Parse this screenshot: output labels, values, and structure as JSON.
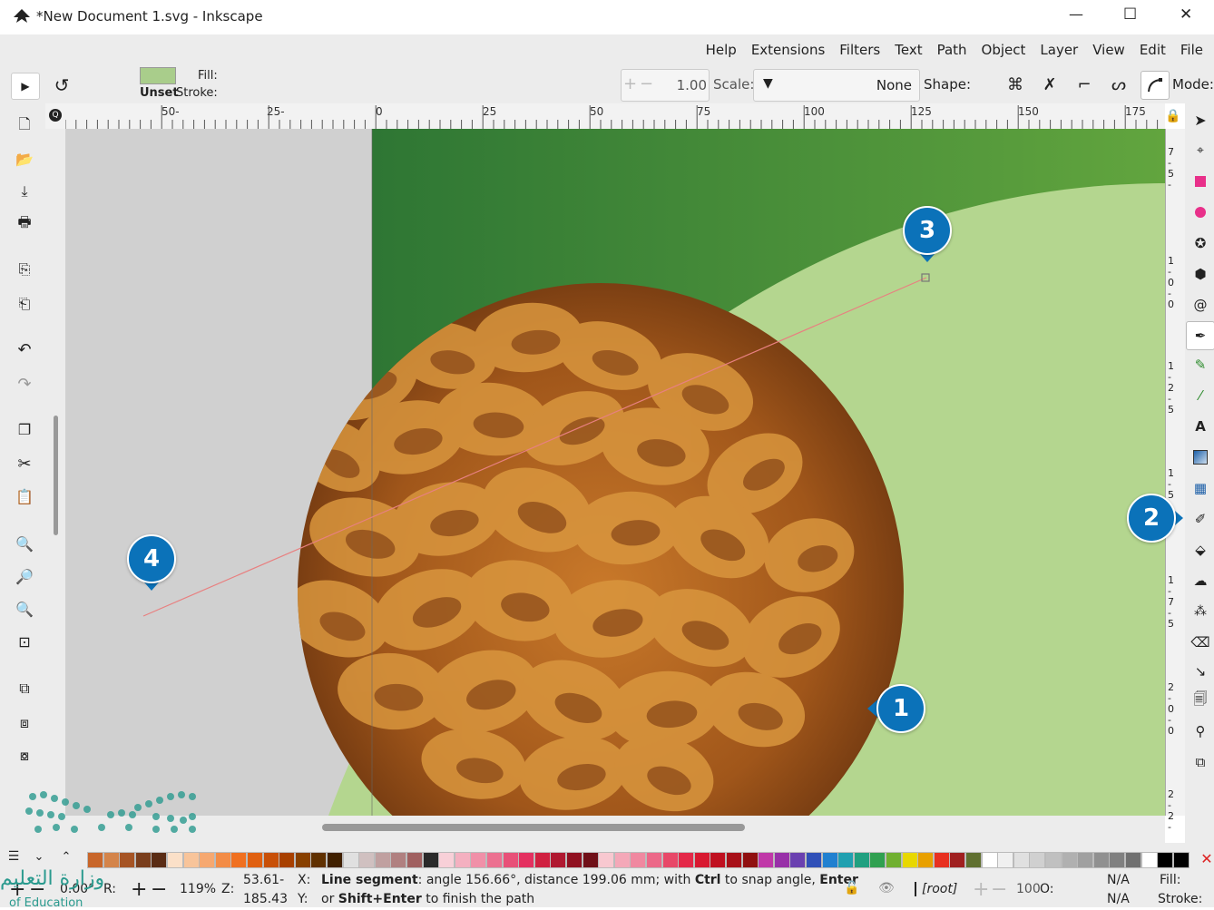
{
  "window": {
    "title": "*New Document 1.svg - Inkscape",
    "minimize_glyph": "—",
    "maximize_glyph": "☐",
    "close_glyph": "✕"
  },
  "menu": [
    "File",
    "Edit",
    "View",
    "Layer",
    "Object",
    "Path",
    "Text",
    "Filters",
    "Extensions",
    "Help"
  ],
  "tool_controls": {
    "mode_label": "Mode:",
    "shape_label": "Shape:",
    "shape_value": "None",
    "scale_label": "Scale:",
    "scale_value": "1.00",
    "fill_label": "Fill:",
    "stroke_label": "Stroke:",
    "stroke_value": "Unset",
    "fill_color": "#a9cd8b"
  },
  "ruler_top": [
    "50-",
    "25-",
    "0",
    "25",
    "50",
    "75",
    "100",
    "125",
    "150",
    "175"
  ],
  "ruler_right": [
    "7-5-",
    "1-0-0",
    "1-2-5",
    "1-5-",
    "1-7-5",
    "2-0-0",
    "2-2-"
  ],
  "badges": [
    "1",
    "2",
    "3",
    "4"
  ],
  "colors": {
    "accent_blue": "#0b72b9",
    "canvas_bg": "#d0d0d0",
    "green_dark": "#2f7a36",
    "green_light": "#b4d68f",
    "path_line": "#e88080"
  },
  "status": {
    "zoom_value": "119%",
    "zoom_label": "Z:",
    "rotate_value": "0.00°",
    "rotate_label": "R:",
    "coord_x": "53.61-",
    "coord_y": "185.43",
    "x_label": "X:",
    "y_label": "Y:",
    "message_bold1": "Line segment",
    "message_part1": ": angle 156.66°, distance 199.06 mm; with ",
    "message_bold2": "Ctrl",
    "message_part2": " to snap angle, ",
    "message_bold3": "Enter",
    "message_line2_a": "or ",
    "message_bold4": "Shift+Enter",
    "message_line2_b": " to finish the path",
    "layer": "[root]",
    "opacity_value": "100",
    "opacity_label": "O:",
    "fill_label": "Fill:",
    "fill_value": "N/A",
    "stroke_label": "Stroke:",
    "stroke_value": "N/A"
  },
  "watermark": {
    "arabic_text": "وزارة التعليم",
    "english_text": "of Education"
  }
}
